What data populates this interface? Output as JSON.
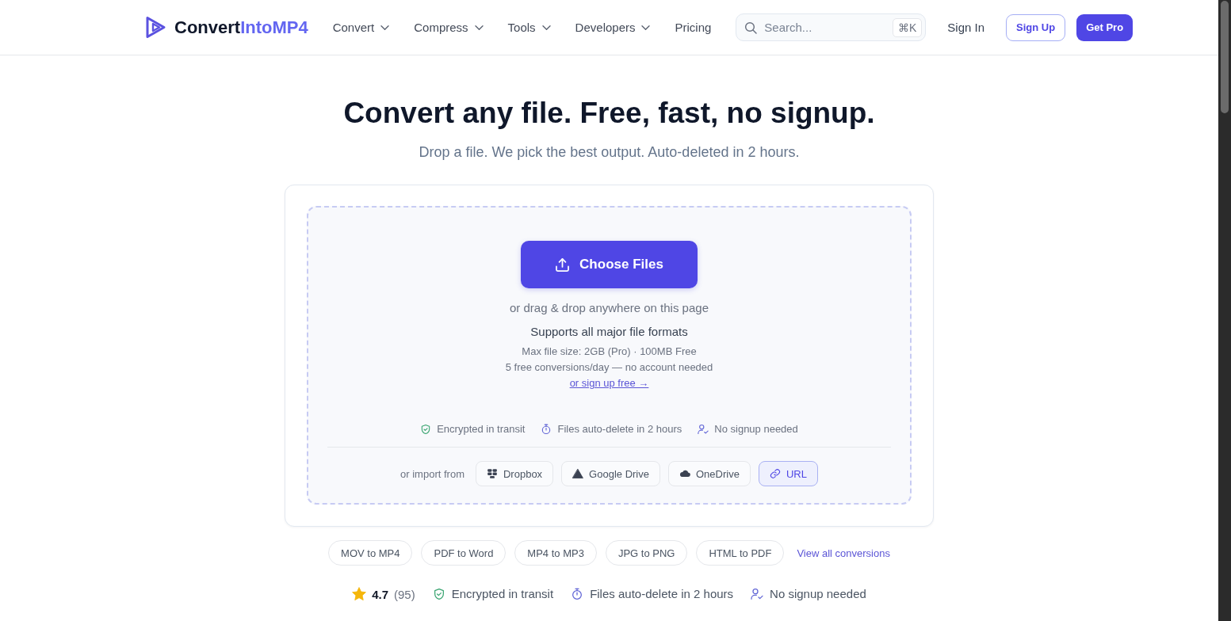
{
  "header": {
    "logo": {
      "name": "Convert",
      "accent": "IntoMP4"
    },
    "nav": [
      {
        "label": "Convert",
        "kind": "menu"
      },
      {
        "label": "Compress",
        "kind": "menu"
      },
      {
        "label": "Tools",
        "kind": "menu"
      },
      {
        "label": "Developers",
        "kind": "menu"
      },
      {
        "label": "Pricing",
        "kind": "link"
      }
    ],
    "search": {
      "placeholder": "Search...",
      "shortcut": "⌘K"
    },
    "sign_in": "Sign In",
    "sign_up": "Sign Up",
    "get_pro": "Get Pro"
  },
  "hero": {
    "title": "Convert any file. Free, fast, no signup.",
    "subtitle": "Drop a file. We pick the best output. Auto-deleted in 2 hours."
  },
  "upload": {
    "button": "Choose Files",
    "drag_hint": "or drag & drop anywhere on this page",
    "formats": "Supports all major file formats",
    "limits": [
      "Max file size: 2GB (Pro) · 100MB Free",
      "5 free conversions/day — no account needed"
    ],
    "signup_link": "or sign up free →",
    "trust": [
      {
        "kind": "shield",
        "label": "Encrypted in transit"
      },
      {
        "kind": "timer",
        "label": "Files auto-delete in 2 hours"
      },
      {
        "kind": "user",
        "label": "No signup needed"
      }
    ],
    "import": {
      "label": "or import from",
      "sources": [
        {
          "kind": "boxes",
          "label": "Dropbox",
          "selected": false
        },
        {
          "kind": "triangle",
          "label": "Google Drive",
          "selected": false
        },
        {
          "kind": "cloud",
          "label": "OneDrive",
          "selected": false
        },
        {
          "kind": "link",
          "label": "URL",
          "selected": true
        }
      ]
    }
  },
  "popular": {
    "conversions": [
      "MOV to MP4",
      "PDF to Word",
      "MP4 to MP3",
      "JPG to PNG",
      "HTML to PDF"
    ],
    "view_all": "View all conversions"
  },
  "stats": {
    "rating": {
      "score": "4.7",
      "count": "(95)"
    },
    "trust": [
      {
        "kind": "shield",
        "label": "Encrypted in transit"
      },
      {
        "kind": "timer",
        "label": "Files auto-delete in 2 hours"
      },
      {
        "kind": "user",
        "label": "No signup needed"
      }
    ]
  }
}
